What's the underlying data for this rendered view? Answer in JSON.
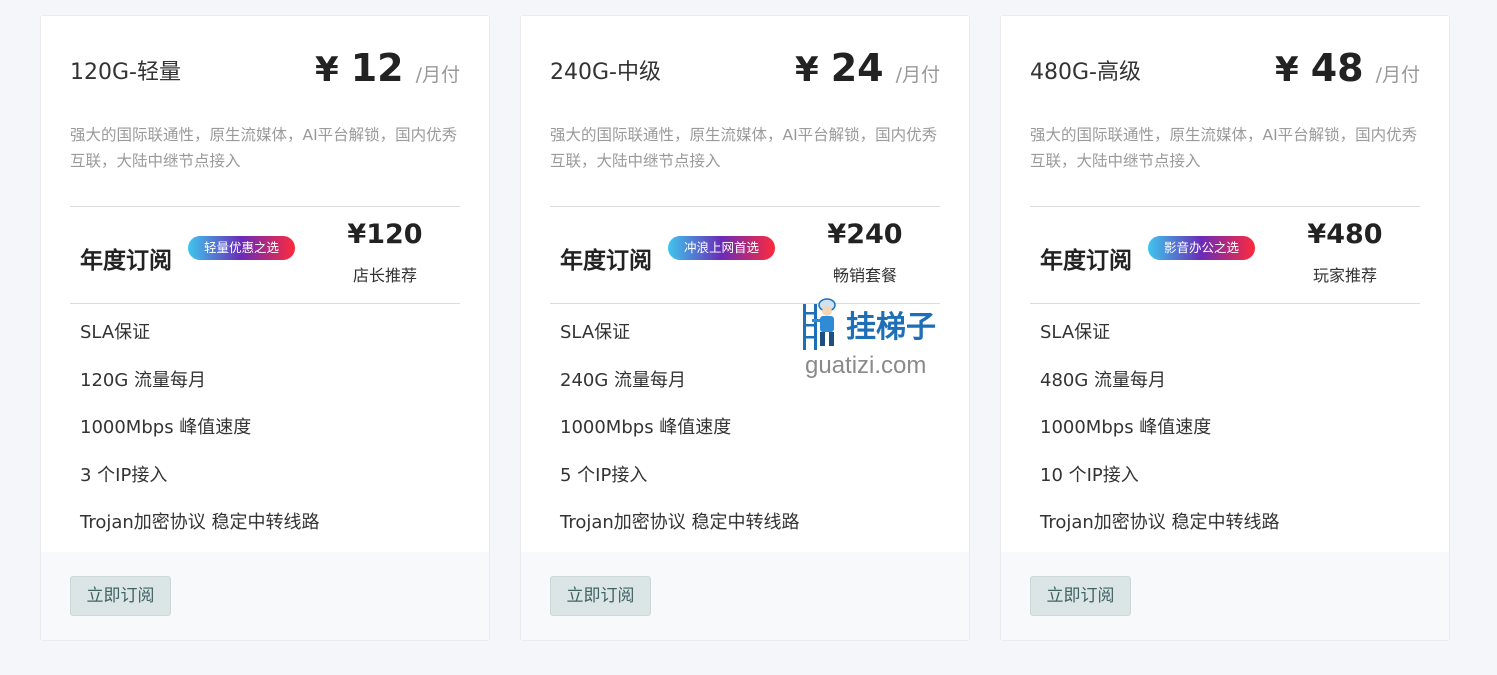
{
  "plans": [
    {
      "name": "120G-轻量",
      "currency": "¥",
      "price": "12",
      "unit": "/月付",
      "description": "强大的国际联通性，原生流媒体，AI平台解锁，国内优秀互联，大陆中继节点接入",
      "annual_title": "年度订阅",
      "badge": "轻量优惠之选",
      "annual_price": "¥120",
      "annual_note": "店长推荐",
      "features": [
        "SLA保证",
        "120G 流量每月",
        "1000Mbps 峰值速度",
        "3 个IP接入",
        "Trojan加密协议 稳定中转线路"
      ],
      "button": "立即订阅"
    },
    {
      "name": "240G-中级",
      "currency": "¥",
      "price": "24",
      "unit": "/月付",
      "description": "强大的国际联通性，原生流媒体，AI平台解锁，国内优秀互联，大陆中继节点接入",
      "annual_title": "年度订阅",
      "badge": "冲浪上网首选",
      "annual_price": "¥240",
      "annual_note": "畅销套餐",
      "features": [
        "SLA保证",
        "240G 流量每月",
        "1000Mbps 峰值速度",
        "5 个IP接入",
        "Trojan加密协议 稳定中转线路"
      ],
      "button": "立即订阅"
    },
    {
      "name": "480G-高级",
      "currency": "¥",
      "price": "48",
      "unit": "/月付",
      "description": "强大的国际联通性，原生流媒体，AI平台解锁，国内优秀互联，大陆中继节点接入",
      "annual_title": "年度订阅",
      "badge": "影音办公之选",
      "annual_price": "¥480",
      "annual_note": "玩家推荐",
      "features": [
        "SLA保证",
        "480G 流量每月",
        "1000Mbps 峰值速度",
        "10 个IP接入",
        "Trojan加密协议 稳定中转线路"
      ],
      "button": "立即订阅"
    }
  ],
  "watermark": {
    "brand_cn": "挂梯子",
    "brand_en": "guatizi.com",
    "icon": "ladder-worker-icon"
  },
  "colors": {
    "background": "#f4f6f9",
    "card": "#ffffff",
    "button_bg": "#dce5e5",
    "button_text": "#3f6262",
    "badge_gradient": [
      "#3ec6ec",
      "#6a2bb8",
      "#ff2a3a"
    ],
    "watermark_blue": "#1d6fb8"
  }
}
